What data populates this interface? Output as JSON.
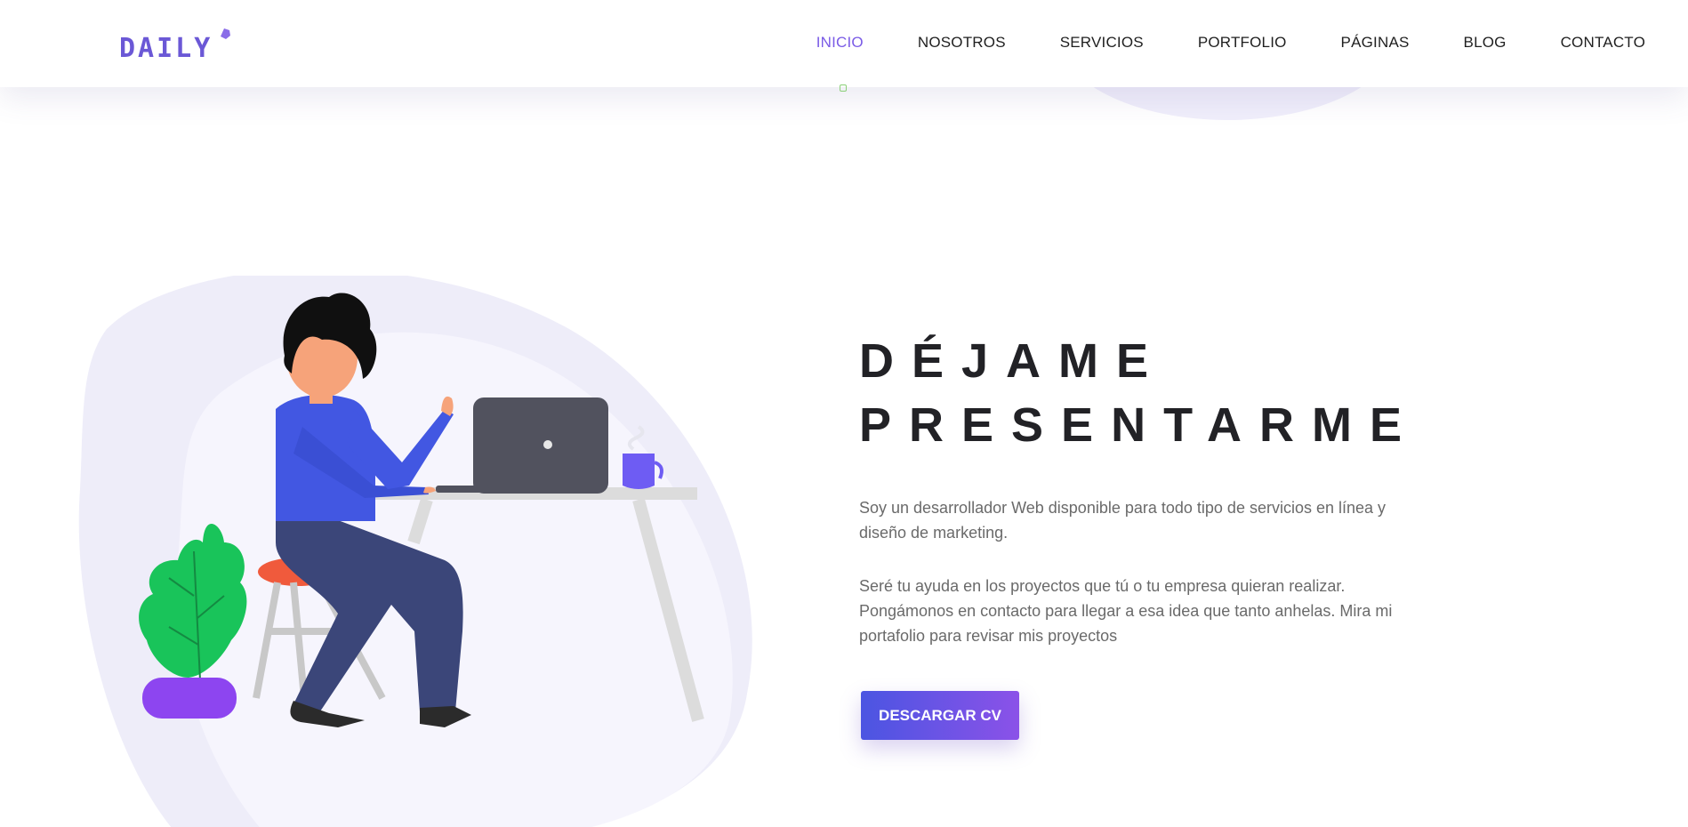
{
  "brand": {
    "logo_text": "DAILY",
    "accent_color": "#7a5be6"
  },
  "nav": {
    "items": [
      {
        "label": "INICIO",
        "active": true
      },
      {
        "label": "NOSOTROS",
        "active": false
      },
      {
        "label": "SERVICIOS",
        "active": false
      },
      {
        "label": "PORTFOLIO",
        "active": false
      },
      {
        "label": "PÁGINAS",
        "active": false
      },
      {
        "label": "BLOG",
        "active": false
      },
      {
        "label": "CONTACTO",
        "active": false
      }
    ]
  },
  "hero": {
    "title_line1": "DÉJAME",
    "title_line2": "PRESENTARME",
    "paragraph1": "Soy un desarrollador Web disponible para todo tipo de servicios en línea y diseño de marketing.",
    "paragraph2": "Seré tu ayuda en los proyectos que tú o tu empresa quieran realizar. Pongámonos en contacto para llegar a esa idea que tanto anhelas. Mira mi portafolio para revisar mis proyectos",
    "cta_label": "DESCARGAR CV",
    "cta_gradient": [
      "#4b55e2",
      "#8b52e8"
    ]
  },
  "illustration": {
    "subject": "person-working-at-laptop-illustration"
  }
}
